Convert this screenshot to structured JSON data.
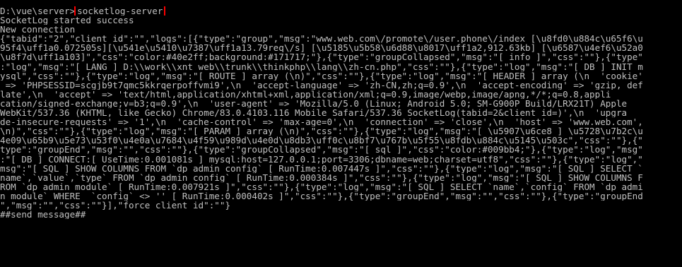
{
  "console": {
    "prompt": "D:\\vue\\server>",
    "command": "socketlog-server",
    "output_lines": [
      "SocketLog started success",
      "New connection",
      "{\"tabid\":\"2\",\"client_id\":\"\",\"logs\":[{\"type\":\"group\",\"msg\":\"www.web.com\\/promote\\/user.phone\\/index [\\u8fd0\\u884c\\u65f6\\u",
      "95f4\\uff1a0.072505s][\\u541e\\u5410\\u7387\\uff1a13.79req\\/s] [\\u5185\\u5b58\\u6d88\\u8017\\uff1a2,912.63kb] [\\u6587\\u4ef6\\u52a0",
      "\\u8f7d\\uff1a103]\",\"css\":\"color:#40e2ff;background:#171717;\"},{\"type\":\"groupCollapsed\",\"msg\":\"[ info ]\",\"css\":\"\"},{\"type\"",
      ":\"log\",\"msg\":\"[ LANG ] D:\\\\work\\\\xnt_web\\\\trunk\\\\thinkphp\\\\lang\\\\zh-cn.php\",\"css\":\"\"},{\"type\":\"log\",\"msg\":\"[ DB ] INIT m",
      "ysql\",\"css\":\"\"},{\"type\":\"log\",\"msg\":\"[ ROUTE ] array (\\n)\",\"css\":\"\"},{\"type\":\"log\",\"msg\":\"[ HEADER ] array (\\n  'cookie'",
      " => 'PHPSESSID=scgjb9t7qmc5kkrqerpoffvmi9',\\n  'accept-language' => 'zh-CN,zh;q=0.9',\\n  'accept-encoding' => 'gzip, def",
      "late',\\n  'accept' => 'text/html,application/xhtml+xml,application/xml;q=0.9,image/webp,image/apng,*/*;q=0.8,appli",
      "cation/signed-exchange;v=b3;q=0.9',\\n  'user-agent' => 'Mozilla/5.0 (Linux; Android 5.0; SM-G900P Build/LRX21T) Apple",
      "WebKit/537.36 (KHTML, like Gecko) Chrome/83.0.4103.116 Mobile Safari/537.36 SocketLog(tabid=2&client_id=)',\\n  'upgra",
      "de-insecure-requests' => '1',\\n  'cache-control' => 'max-age=0',\\n  'connection' => 'close',\\n  'host' => 'www.web.com',",
      "\\n)\",\"css\":\"\"},{\"type\":\"log\",\"msg\":\"[ PARAM ] array (\\n)\",\"css\":\"\"},{\"type\":\"log\",\"msg\":\"[ \\u5907\\u6ce8 ] \\u5728\\u7b2c\\u",
      "4e09\\u65b9\\u5e73\\u53f0\\u4e0a\\u7684\\u4f59\\u989d\\u4e0d\\u8db3\\uff0c\\u8bf7\\u767b\\u5f55\\u8fdb\\u884c\\u5145\\u503c\",\"css\":\"\"},{\"",
      "type\":\"groupEnd\",\"msg\":\"\",\"css\":\"\"},{\"type\":\"groupCollapsed\",\"msg\":\"[ sql ]\",\"css\":\"color:#009bb4;\"},{\"type\":\"log\",\"msg\"",
      ":\"[ DB ] CONNECT:[ UseTime:0.001081s ] mysql:host=127.0.0.1;port=3306;dbname=web;charset=utf8\",\"css\":\"\"},{\"type\":\"log\",\"",
      "msg\":\"[ SQL ] SHOW COLUMNS FROM `dp_admin_config` [ RunTime:0.007447s ]\",\"css\":\"\"},{\"type\":\"log\",\"msg\":\"[ SQL ] SELECT `",
      "name`,`value`,`type` FROM `dp_admin_config` [ RunTime:0.000384s ]\",\"css\":\"\"},{\"type\":\"log\",\"msg\":\"[ SQL ] SHOW COLUMNS F",
      "ROM `dp_admin_module` [ RunTime:0.007921s ]\",\"css\":\"\"},{\"type\":\"log\",\"msg\":\"[ SQL ] SELECT `name`,`config` FROM `dp_admi",
      "n_module` WHERE  `config` <> '' [ RunTime:0.000402s ]\",\"css\":\"\"},{\"type\":\"groupEnd\",\"msg\":\"\",\"css\":\"\"},{\"type\":\"groupEnd",
      "\",\"msg\":\"\",\"css\":\"\"}],\"force_client_id\":\"\"}",
      "##send message##"
    ]
  },
  "colors": {
    "background": "#000000",
    "text": "#c0c0c0",
    "highlight_border": "#ff0000"
  }
}
